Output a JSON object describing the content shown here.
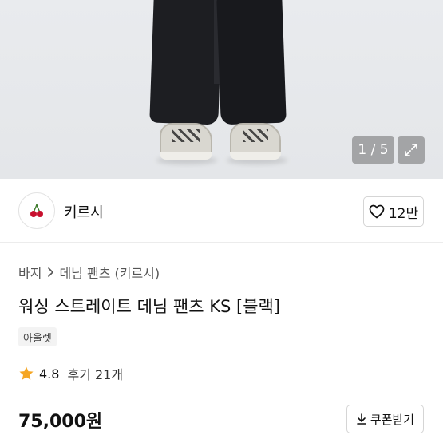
{
  "gallery": {
    "counter": "1 / 5",
    "expand_icon": "expand-icon"
  },
  "store": {
    "name": "키르시",
    "logo_icon": "cherry-icon",
    "like_count": "12만",
    "like_icon": "heart-outline-icon"
  },
  "breadcrumb": {
    "category": "바지",
    "separator_icon": "chevron-right-icon",
    "subcategory": "데님 팬츠 (키르시)"
  },
  "product": {
    "title": "워싱 스트레이트 데님 팬츠 KS [블랙]",
    "tag": "아울렛",
    "rating": "4.8",
    "reviews": "후기 21개",
    "price": "75,000원"
  },
  "actions": {
    "coupon_label": "쿠폰받기",
    "coupon_icon": "download-icon"
  },
  "colors": {
    "star": "#f5a623",
    "cherry": "#c8102e"
  }
}
